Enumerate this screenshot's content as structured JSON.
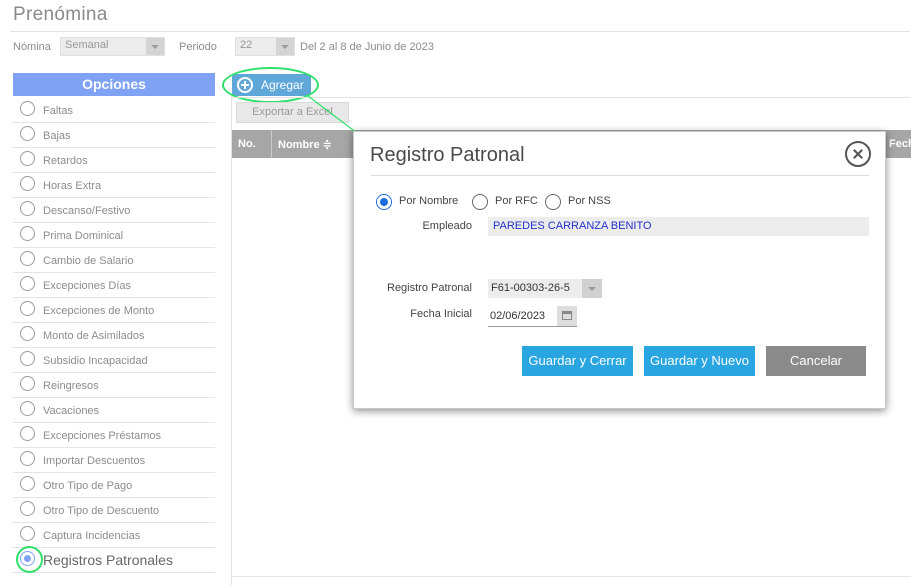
{
  "page": {
    "title": "Prenómina"
  },
  "filters": {
    "nomina_label": "Nómina",
    "nomina_value": "Semanal",
    "periodo_label": "Periodo",
    "periodo_value": "22",
    "periodo_text": "Del 2 al 8 de Junio de 2023"
  },
  "options": {
    "header": "Opciones",
    "items": [
      {
        "label": "Faltas"
      },
      {
        "label": "Bajas"
      },
      {
        "label": "Retardos"
      },
      {
        "label": "Horas Extra"
      },
      {
        "label": "Descanso/Festivo"
      },
      {
        "label": "Prima Dominical"
      },
      {
        "label": "Cambio de Salario"
      },
      {
        "label": "Excepciones Días"
      },
      {
        "label": "Excepciones de Monto"
      },
      {
        "label": "Monto de Asimilados"
      },
      {
        "label": "Subsidio Incapacidad"
      },
      {
        "label": "Reingresos"
      },
      {
        "label": "Vacaciones"
      },
      {
        "label": "Excepciones Préstamos"
      },
      {
        "label": "Importar Descuentos"
      },
      {
        "label": "Otro Tipo de Pago"
      },
      {
        "label": "Otro Tipo de Descuento"
      },
      {
        "label": "Captura Incidencias"
      },
      {
        "label": "Registros Patronales"
      }
    ],
    "selected": "Registros Patronales"
  },
  "toolbar": {
    "add_label": "Agregar",
    "export_label": "Exportar a Excel"
  },
  "table": {
    "columns": [
      "No.",
      "Nombre ≑",
      "Fech"
    ]
  },
  "modal": {
    "title": "Registro Patronal",
    "search_options": [
      "Por Nombre",
      "Por RFC",
      "Por NSS"
    ],
    "selected_search": "Por Nombre",
    "employee_label": "Empleado",
    "employee_value": "PAREDES CARRANZA BENITO",
    "registro_label": "Registro Patronal",
    "registro_value": "F61-00303-26-5",
    "fecha_label": "Fecha Inicial",
    "fecha_value": "02/06/2023",
    "buttons": {
      "save_close": "Guardar y Cerrar",
      "save_new": "Guardar y Nuevo",
      "cancel": "Cancelar"
    }
  },
  "colors": {
    "accent": "#7fa2f5",
    "button_blue": "#29a6e2",
    "highlight": "#2ee06a",
    "add_button": "#5fa6d9"
  }
}
